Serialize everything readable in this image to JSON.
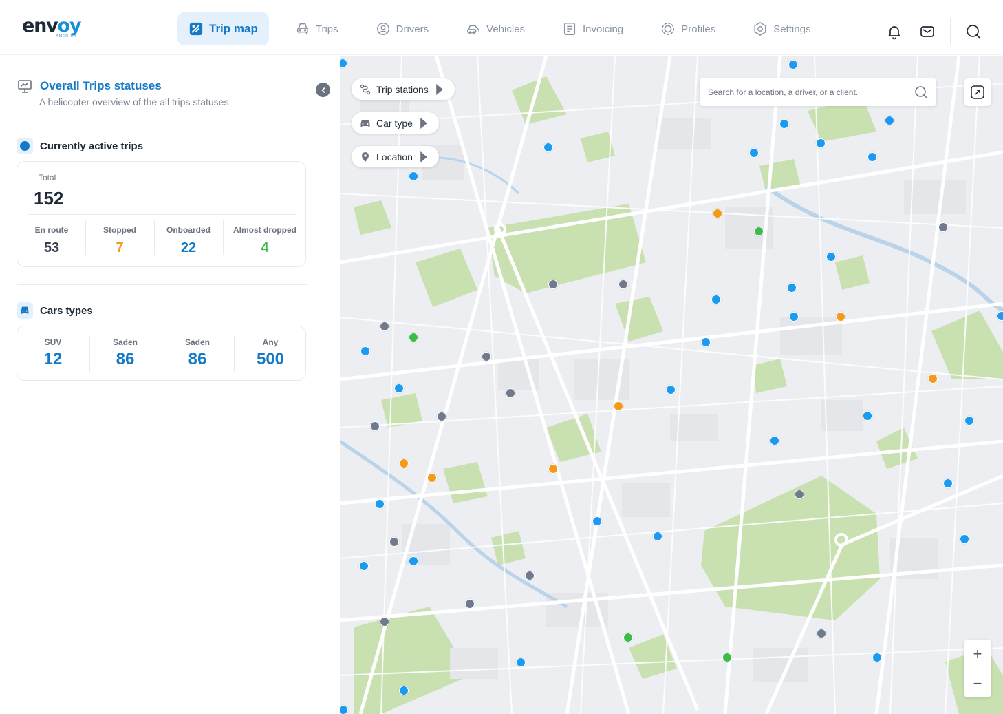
{
  "brand": {
    "name_left": "env",
    "name_accent": "oy",
    "sub": "AMERICA"
  },
  "nav": {
    "items": [
      {
        "label": "Trip map",
        "icon": "map-icon",
        "active": true
      },
      {
        "label": "Trips",
        "icon": "car-front-icon"
      },
      {
        "label": "Drivers",
        "icon": "user-circle-icon"
      },
      {
        "label": "Vehicles",
        "icon": "vehicle-icon"
      },
      {
        "label": "Invoicing",
        "icon": "invoice-icon"
      },
      {
        "label": "Profiles",
        "icon": "profiles-icon"
      },
      {
        "label": "Settings",
        "icon": "gear-icon"
      }
    ]
  },
  "header_actions": {
    "icons": [
      "bell-icon",
      "mail-icon",
      "search-icon"
    ]
  },
  "sidebar": {
    "overview_title": "Overall Trips statuses",
    "overview_subtitle": "A helicopter overview of the all trips statuses.",
    "active_title": "Currently active trips",
    "total_label": "Total",
    "total_value": "152",
    "stats": [
      {
        "label": "En route",
        "value": "53",
        "color": "#374151"
      },
      {
        "label": "Stopped",
        "value": "7",
        "color": "#f39a18"
      },
      {
        "label": "Onboarded",
        "value": "22",
        "color": "#1479c7"
      },
      {
        "label": "Almost dropped",
        "value": "4",
        "color": "#3dbb4a"
      }
    ],
    "cars_title": "Cars types",
    "cars": [
      {
        "label": "SUV",
        "value": "12"
      },
      {
        "label": "Saden",
        "value": "86"
      },
      {
        "label": "Saden",
        "value": "86"
      },
      {
        "label": "Any",
        "value": "500"
      }
    ]
  },
  "map": {
    "filters": [
      {
        "label": "Trip stations",
        "icon": "route-icon"
      },
      {
        "label": "Car type",
        "icon": "car-icon"
      },
      {
        "label": "Location",
        "icon": "location-pin-icon"
      }
    ],
    "search_placeholder": "Search for a location, a driver, or a client.",
    "zoom_in": "+",
    "zoom_out": "−",
    "colors": {
      "blue": "#1a9af0",
      "gray": "#6f7b8c",
      "orange": "#f39a18",
      "green": "#3dbb4a"
    },
    "marker_counts": {
      "blue": 38,
      "gray": 15,
      "orange": 8,
      "green": 4
    }
  }
}
